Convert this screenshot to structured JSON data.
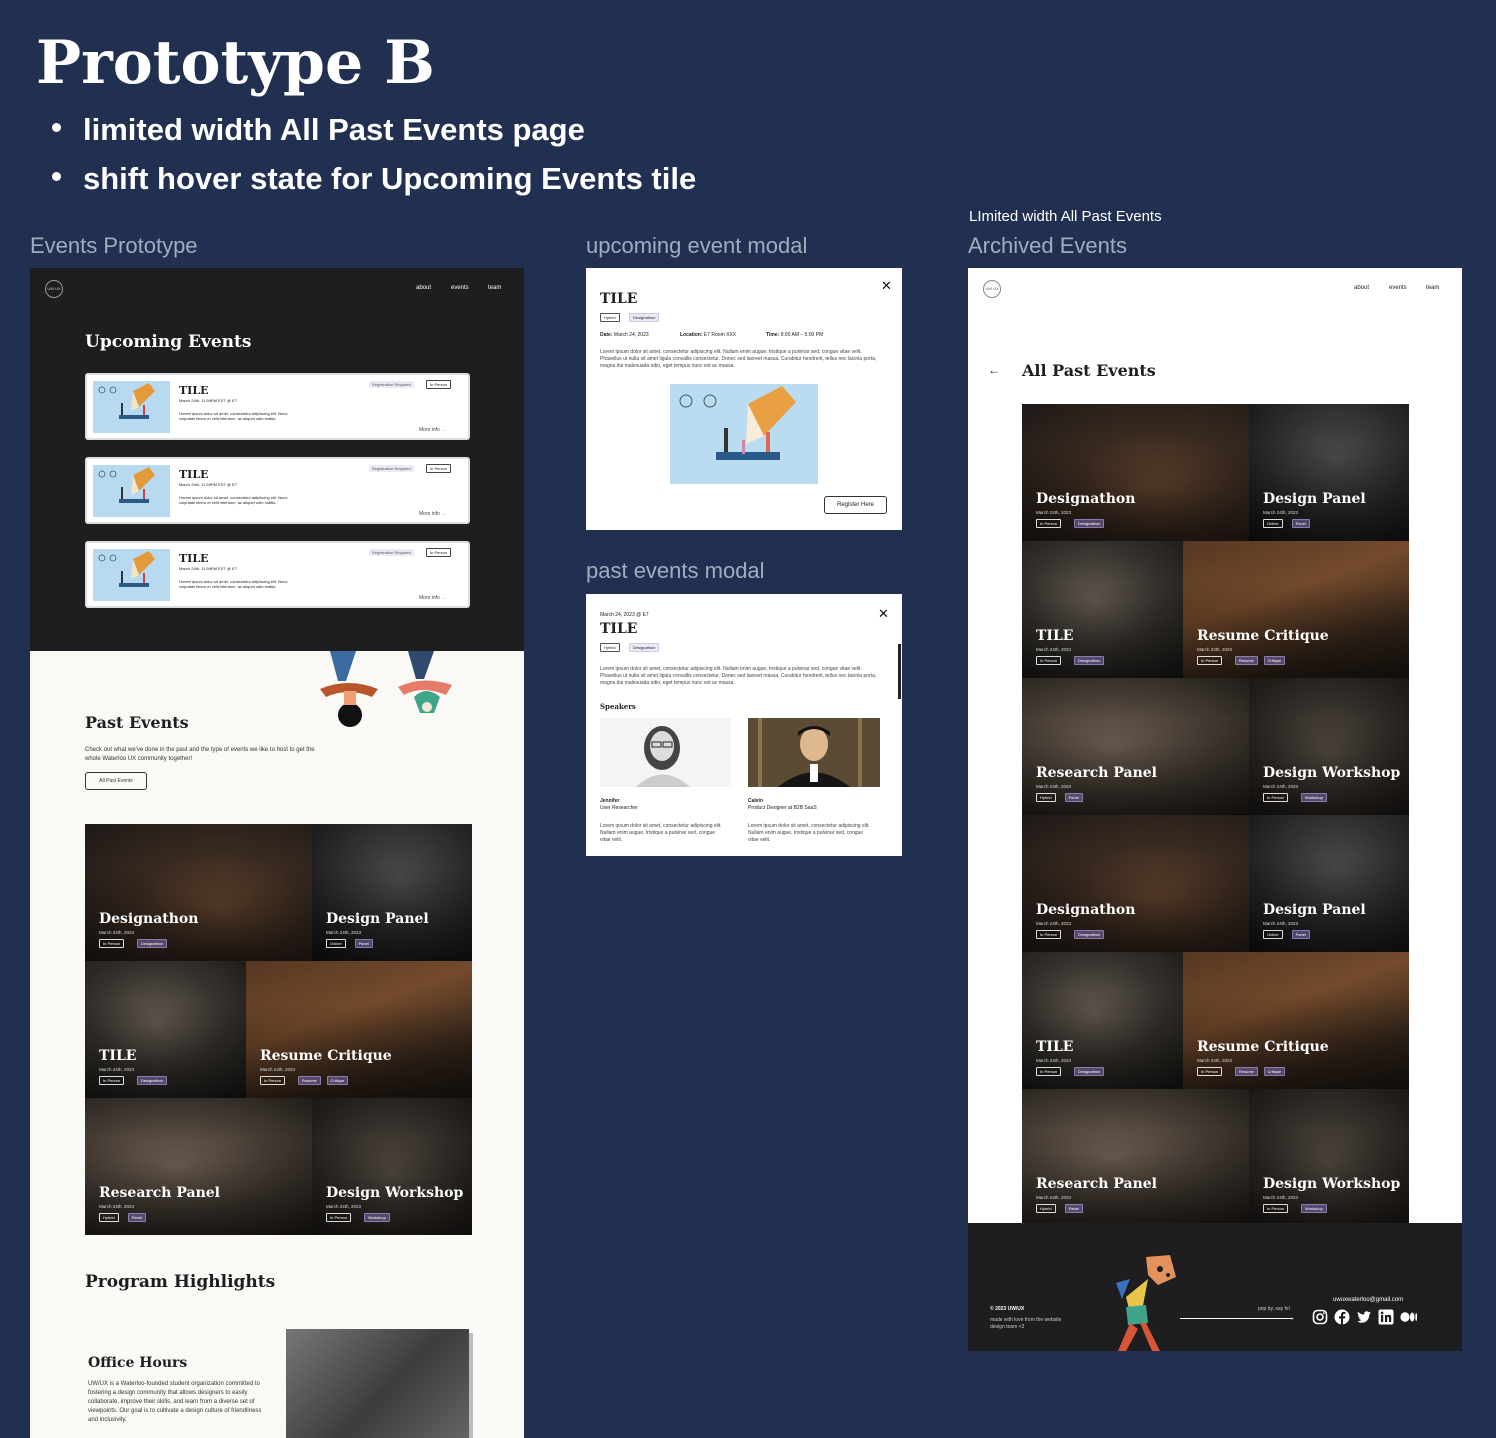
{
  "heading": {
    "title": "Prototype B",
    "bullets": [
      "limited width All Past Events page",
      "shift hover state for Upcoming Events tile"
    ]
  },
  "frame_labels": {
    "events_prototype": "Events Prototype",
    "upcoming_modal": "upcoming event modal",
    "past_modal": "past events modal",
    "archive_note": "LImited width All Past Events",
    "archived": "Archived Events"
  },
  "site": {
    "logo": "UW UX",
    "nav": [
      "about",
      "events",
      "team"
    ]
  },
  "events_page": {
    "upcoming_title": "Upcoming Events",
    "upcoming_cards": [
      {
        "title": "TILE",
        "date": "March 24th, 11:59PM EST @ E7",
        "desc": "Horem ipsum dolor sit amet, consectetur adipiscing elit. Nunc vulputate libero et velit interdum, ac aliquet odio mattis.",
        "tag_reg": "Registration Required",
        "tag_mode": "In Person",
        "more": "More info →"
      },
      {
        "title": "TILE",
        "date": "March 24th, 11:59PM EST @ E7",
        "desc": "Horem ipsum dolor sit amet, consectetur adipiscing elit. Nunc vulputate libero et velit interdum, ac aliquet odio mattis.",
        "tag_reg": "Registration Required",
        "tag_mode": "In Person",
        "more": "More info →"
      },
      {
        "title": "TILE",
        "date": "March 24th, 11:59PM EST @ E7",
        "desc": "Horem ipsum dolor sit amet, consectetur adipiscing elit. Nunc vulputate libero et velit interdum, ac aliquet odio mattis.",
        "tag_reg": "Registration Required",
        "tag_mode": "In Person",
        "more": "More info →"
      }
    ],
    "past_title": "Past Events",
    "past_desc": "Check out what we've done in the past and the type of events we like to host to get the whole Waterloo UX community together!",
    "past_button": "All Past Events",
    "highlights_title": "Program Highlights",
    "office_hours_title": "Office Hours",
    "office_hours_desc": "UW/UX is a Waterloo-founded student organization committed to fostering a design community that allows designers to easily collaborate, improve their skills, and learn from a diverse set of viewpoints. Our goal is to cultivate a design culture of friendliness and inclusivity."
  },
  "past_tiles": [
    {
      "name": "Designathon",
      "date": "March 24th, 2023",
      "tags": [
        "In Person",
        "Designathon"
      ]
    },
    {
      "name": "Design Panel",
      "date": "March 24th, 2023",
      "tags": [
        "Online",
        "Panel"
      ]
    },
    {
      "name": "TILE",
      "date": "March 24th, 2023",
      "tags": [
        "In Person",
        "Designathon"
      ]
    },
    {
      "name": "Resume Critique",
      "date": "March 24th, 2023",
      "tags": [
        "In Person",
        "Resume",
        "Critique"
      ]
    },
    {
      "name": "Research Panel",
      "date": "March 24th, 2023",
      "tags": [
        "Hybrid",
        "Panel"
      ]
    },
    {
      "name": "Design Workshop",
      "date": "March 24th, 2023",
      "tags": [
        "In Person",
        "Workshop"
      ]
    }
  ],
  "upcoming_modal": {
    "close": "✕",
    "title": "TILE",
    "pills": [
      "Hybrid",
      "Designathon"
    ],
    "date_label": "Date:",
    "date": "March 24, 2023",
    "location_label": "Location:",
    "location": "E7 Room XXX",
    "time_label": "Time:",
    "time": "9:00 AM – 5:00 PM",
    "desc": "Lorem ipsum dolor sit amet, consectetur adipiscing elit. Nullam enim augue, tristique a pulvinar sed, congue vitae velit. Phasellus ut nulla sit amet ligula convallis consectetur. Donec sed laoreet massa. Curabitur hendrerit, tellus nec lacinia porta, magna dui malesuada odio, eget tempus nunc est ac massa.",
    "register": "Register Here"
  },
  "past_modal": {
    "close": "✕",
    "date": "March 24, 2023 @ E7",
    "title": "TILE",
    "pills": [
      "Hybrid",
      "Designathon"
    ],
    "desc": "Lorem ipsum dolor sit amet, consectetur adipiscing elit. Nullam enim augue, tristique a pulvinar sed, congue vitae velit. Phasellus ut nulla sit amet ligula convallis consectetur. Donec sed laoreet massa. Curabitur hendrerit, tellus nec lacinia porta, magna dui malesuada odio, eget tempus nunc est ac massa.",
    "speakers_label": "Speakers",
    "speakers": [
      {
        "name": "Jennifer",
        "role": "User Researcher",
        "bio": "Lorem ipsum dolor sit amet, consectetur adipiscing elit. Nullam enim augue, tristique a pulvinar sed, congue vitae velit."
      },
      {
        "name": "Calvin",
        "role": "Product Designer at B2B SaaS",
        "bio": "Lorem ipsum dolor sit amet, consectetur adipiscing elit. Nullam enim augue, tristique a pulvinar sed, congue vitae velit."
      }
    ]
  },
  "archive_page": {
    "back": "←",
    "title": "All Past Events",
    "footer": {
      "copyright": "© 2023 UW/UX",
      "credit": "made with love from the website design team <3",
      "say_hi": "pop by, say hi!",
      "email": "uwuxwaterloo@gmail.com",
      "socials": [
        "instagram-icon",
        "facebook-icon",
        "twitter-icon",
        "linkedin-icon",
        "medium-icon"
      ]
    }
  }
}
